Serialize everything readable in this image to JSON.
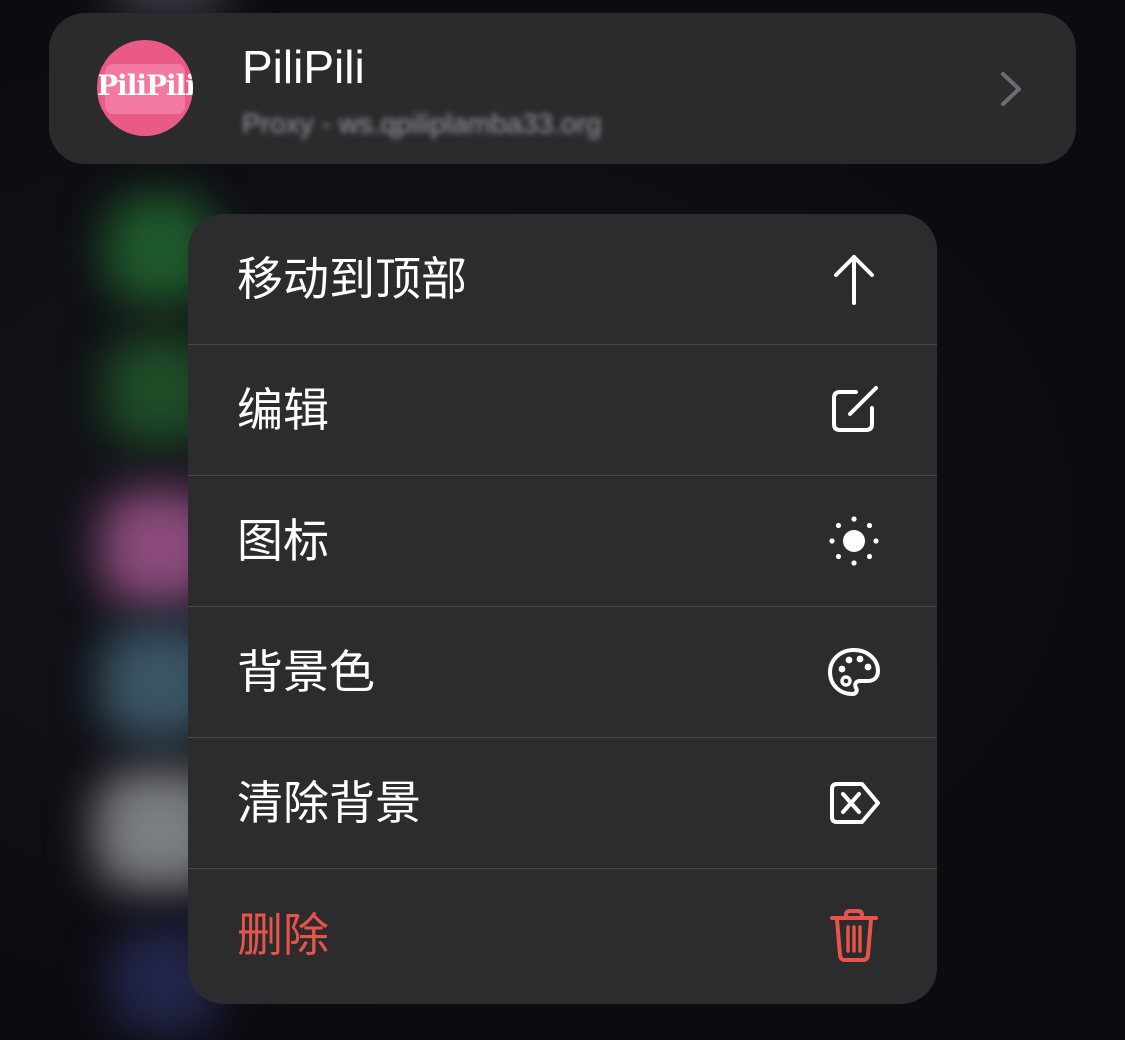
{
  "app": {
    "name": "PiliPili",
    "subtitle": "Proxy - ws.qpiliplamba33.org",
    "icon_text": "PiliPili",
    "icon_color": "#ea5a87"
  },
  "menu": {
    "items": [
      {
        "label": "移动到顶部",
        "icon": "arrow-up-icon"
      },
      {
        "label": "编辑",
        "icon": "edit-square-icon"
      },
      {
        "label": "图标",
        "icon": "sun-icon"
      },
      {
        "label": "背景色",
        "icon": "palette-icon"
      },
      {
        "label": "清除背景",
        "icon": "clear-tag-icon"
      },
      {
        "label": "删除",
        "icon": "trash-icon",
        "color": "#e9544a"
      }
    ]
  },
  "colors": {
    "menu_bg": "#2c2c2f",
    "text": "#ffffff",
    "danger": "#e9544a"
  }
}
